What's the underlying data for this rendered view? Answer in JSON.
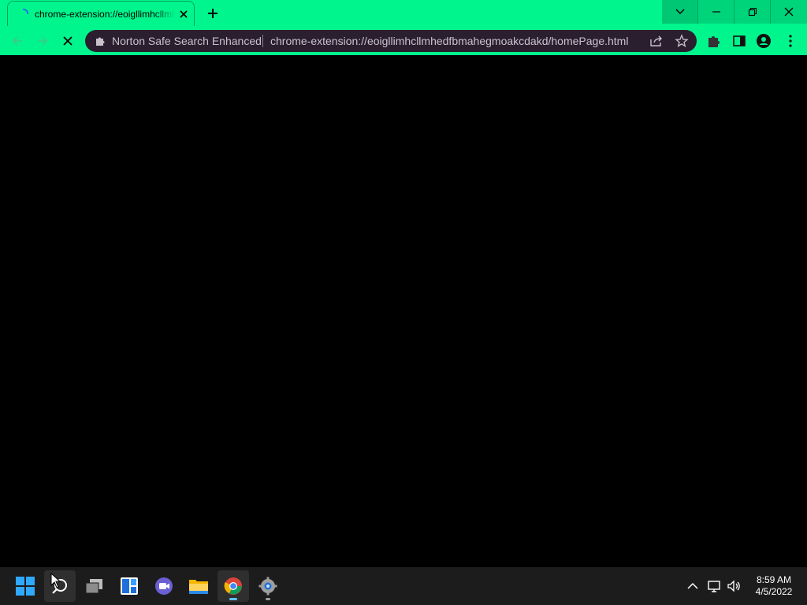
{
  "browser": {
    "tab": {
      "title": "chrome-extension://eoigllimhcllmhedfbmahegmoakcdakd/homePage.html"
    },
    "omnibox": {
      "chip_label": "Norton Safe Search Enhanced",
      "url": "chrome-extension://eoigllimhcllmhedfbmahegmoakcdakd/homePage.html"
    },
    "colors": {
      "frame": "#00f58c",
      "omnibox_bg": "#2a1e2f",
      "content_bg": "#000000"
    }
  },
  "taskbar": {
    "apps": [
      "start-icon",
      "search-icon",
      "task-view-icon",
      "widgets-icon",
      "teams-chat-icon",
      "file-explorer-icon",
      "chrome-icon",
      "settings-icon"
    ],
    "clock": {
      "time": "8:59 AM",
      "date": "4/5/2022"
    }
  }
}
